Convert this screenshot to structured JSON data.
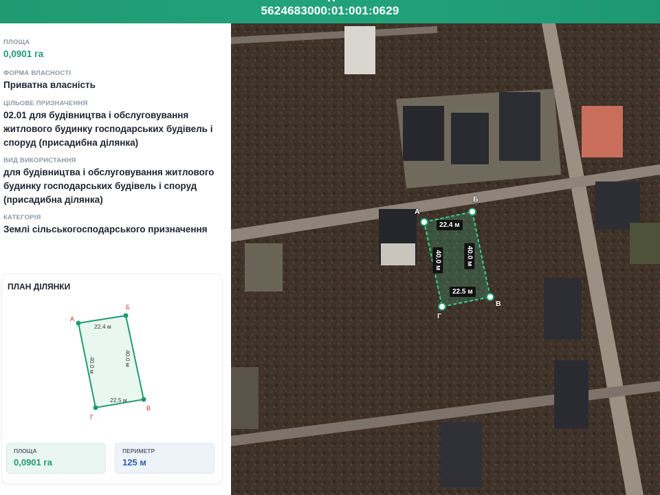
{
  "header": {
    "cadastral_number": "5624683000:01:001:0629"
  },
  "info": {
    "area": {
      "label": "ПЛОЩА",
      "value": "0,0901 га"
    },
    "ownership": {
      "label": "ФОРМА ВЛАСНОСТІ",
      "value": "Приватна власність"
    },
    "purpose": {
      "label": "ЦІЛЬОВЕ ПРИЗНАЧЕННЯ",
      "value": "02.01 для будівництва і обслуговування житлового будинку господарських будівель і споруд (присадибна ділянка)"
    },
    "usage": {
      "label": "ВИД ВИКОРИСТАННЯ",
      "value": "для будівництва і обслуговування житлового будинку господарських будівель і споруд (присадибна ділянка)"
    },
    "category": {
      "label": "КАТЕГОРІЯ",
      "value": "Землі сільськогосподарського призначення"
    }
  },
  "plan": {
    "title": "ПЛАН ДІЛЯНКИ",
    "vertices": [
      "А",
      "Б",
      "В",
      "Г"
    ],
    "sides": {
      "top": "22.4 м",
      "right": "40.0 м",
      "bottom": "22.5 м",
      "left": "40.0 м"
    },
    "area_label": "ПЛОЩА",
    "area_value": "0,0901 га",
    "perimeter_label": "ПЕРИМЕТР",
    "perimeter_value": "125 м"
  },
  "map": {
    "vertices": [
      "А",
      "Б",
      "В",
      "Г"
    ],
    "sides": {
      "top": "22.4 м",
      "right": "40.0 м",
      "bottom": "22.5 м",
      "left": "40.0 м"
    },
    "colors": {
      "parcel": "#2bd38f",
      "parcel_fill": "rgba(60,200,140,0.22)",
      "accent": "#1f9a71"
    }
  }
}
